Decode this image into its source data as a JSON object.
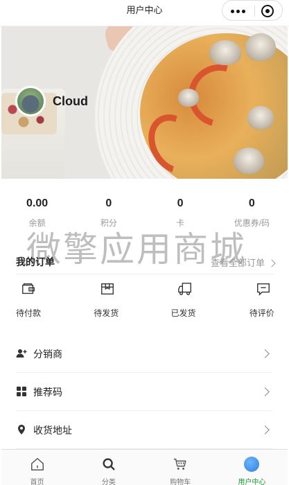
{
  "nav": {
    "title": "用户中心"
  },
  "profile": {
    "username": "Cloud"
  },
  "stats": [
    {
      "value": "0.00",
      "label": "余额"
    },
    {
      "value": "0",
      "label": "积分"
    },
    {
      "value": "0",
      "label": "卡"
    },
    {
      "value": "0",
      "label": "优惠券/码"
    }
  ],
  "watermark": "微擎应用商城",
  "orders": {
    "title": "我的订单",
    "view_all": "查看全部订单",
    "items": [
      {
        "label": "待付款",
        "icon": "wallet-icon"
      },
      {
        "label": "待发货",
        "icon": "box-icon"
      },
      {
        "label": "已发货",
        "icon": "truck-icon"
      },
      {
        "label": "待评价",
        "icon": "comment-icon"
      }
    ]
  },
  "menu": [
    {
      "label": "分销商",
      "icon": "user-plus-icon"
    },
    {
      "label": "推荐码",
      "icon": "grid-icon"
    },
    {
      "label": "收货地址",
      "icon": "location-pin-icon"
    }
  ],
  "tabbar": {
    "items": [
      {
        "label": "首页",
        "icon": "home-icon"
      },
      {
        "label": "分类",
        "icon": "search-icon"
      },
      {
        "label": "购物车",
        "icon": "cart-icon"
      },
      {
        "label": "用户中心",
        "icon": "user-center-icon",
        "active": true
      }
    ],
    "active_color": "#1a9c3a"
  }
}
